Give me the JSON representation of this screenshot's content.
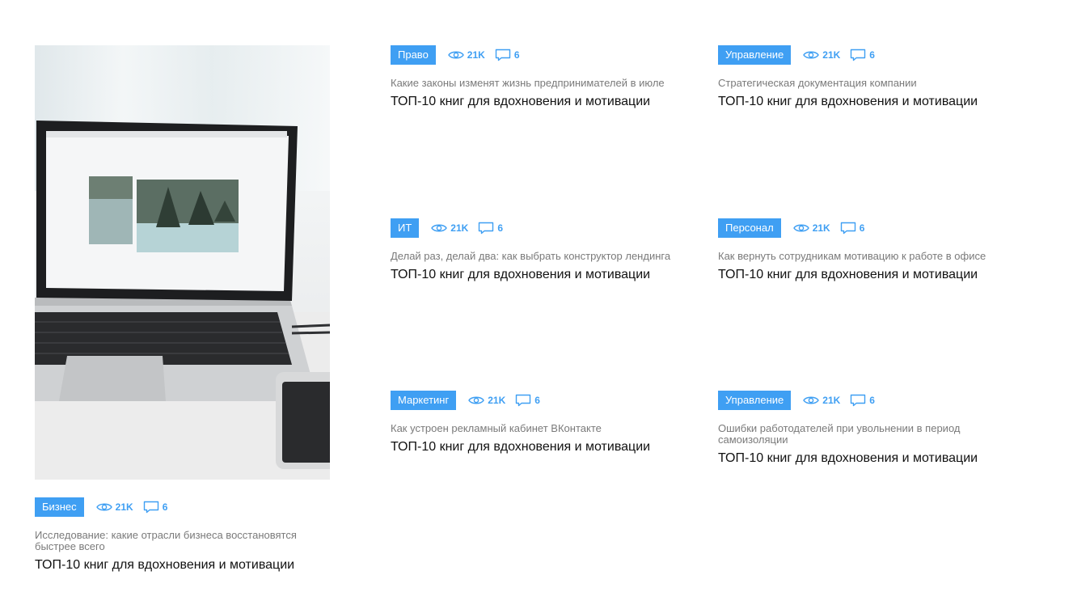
{
  "featured": {
    "tag": "Бизнес",
    "views": "21K",
    "comments": "6",
    "subtitle": "Исследование: какие отрасли бизнеса восстановятся быстрее всего",
    "title": "ТОП-10 книг для вдохновения и мотивации"
  },
  "cards": [
    {
      "tag": "Право",
      "views": "21K",
      "comments": "6",
      "subtitle": "Какие законы изменят жизнь предпринимателей в июле",
      "title": "ТОП-10 книг для вдохновения и мотивации"
    },
    {
      "tag": "Управление",
      "views": "21K",
      "comments": "6",
      "subtitle": "Стратегическая документация компании",
      "title": "ТОП-10 книг для вдохновения и мотивации"
    },
    {
      "tag": "ИТ",
      "views": "21K",
      "comments": "6",
      "subtitle": "Делай раз, делай два: как выбрать конструктор лендинга",
      "title": "ТОП-10 книг для вдохновения и мотивации"
    },
    {
      "tag": "Персонал",
      "views": "21K",
      "comments": "6",
      "subtitle": "Как вернуть сотрудникам мотивацию к работе в офисе",
      "title": "ТОП-10 книг для вдохновения и мотивации"
    },
    {
      "tag": "Маркетинг",
      "views": "21K",
      "comments": "6",
      "subtitle": "Как устроен рекламный кабинет ВКонтакте",
      "title": "ТОП-10 книг для вдохновения и мотивации"
    },
    {
      "tag": "Управление",
      "views": "21K",
      "comments": "6",
      "subtitle": "Ошибки работодателей при увольнении в период самоизоляции",
      "title": "ТОП-10 книг для вдохновения и мотивации"
    }
  ],
  "icons": {
    "views": "eye-icon",
    "comments": "comment-icon"
  },
  "colors": {
    "accent": "#3f9ff3",
    "subtitle": "#7a7a7a",
    "title": "#111111"
  }
}
